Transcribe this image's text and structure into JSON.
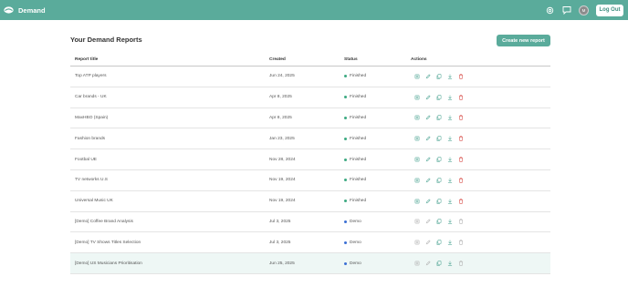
{
  "app": {
    "brand": "Demand"
  },
  "header": {
    "avatar_initial": "M",
    "logout_label": "Log Out",
    "icons": [
      "settings-icon",
      "chat-icon"
    ]
  },
  "page": {
    "title": "Your Demand Reports",
    "create_button": "Create new report"
  },
  "table": {
    "columns": [
      "Report title",
      "Created",
      "Status",
      "Actions"
    ],
    "rows": [
      {
        "title": "Top ATP players",
        "created": "Jun 24, 2025",
        "status": "Finished"
      },
      {
        "title": "Car brands - UK",
        "created": "Apr 8, 2025",
        "status": "Finished"
      },
      {
        "title": "MaxHBO (Spain)",
        "created": "Apr 8, 2025",
        "status": "Finished"
      },
      {
        "title": "Fashion brands",
        "created": "Jan 23, 2025",
        "status": "Finished"
      },
      {
        "title": "Footbal UE",
        "created": "Nov 28, 2024",
        "status": "Finished"
      },
      {
        "title": "TV networks U.S",
        "created": "Nov 19, 2024",
        "status": "Finished"
      },
      {
        "title": "Universal Music UK",
        "created": "Nov 19, 2024",
        "status": "Finished"
      },
      {
        "title": "[Demo] Coffee Brand Analysis",
        "created": "Jul 3, 2025",
        "status": "Demo"
      },
      {
        "title": "[Demo] TV Shows Titles Selection",
        "created": "Jul 3, 2025",
        "status": "Demo"
      },
      {
        "title": "[Demo] US Musicians Prioritisation",
        "created": "Jun 25, 2025",
        "status": "Demo"
      }
    ],
    "action_icons": [
      "view-icon",
      "edit-icon",
      "duplicate-icon",
      "download-icon",
      "delete-icon"
    ]
  },
  "colors": {
    "brand": "#5aab9b",
    "finished": "#3daa82",
    "demo": "#3b6fd4",
    "delete": "#d9534f",
    "action": "#5aab9b"
  }
}
